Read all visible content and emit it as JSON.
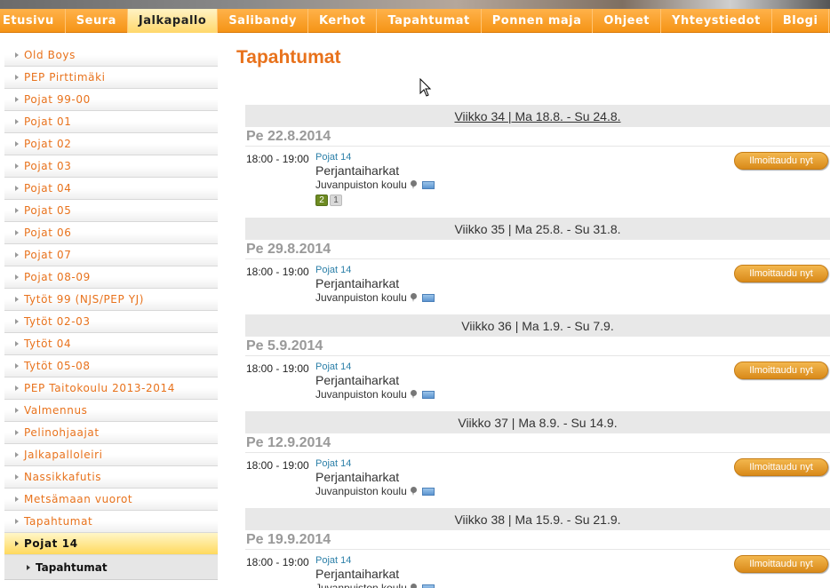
{
  "nav": {
    "items": [
      {
        "label": "Etusivu",
        "active": false
      },
      {
        "label": "Seura",
        "active": false
      },
      {
        "label": "Jalkapallo",
        "active": true
      },
      {
        "label": "Salibandy",
        "active": false
      },
      {
        "label": "Kerhot",
        "active": false
      },
      {
        "label": "Tapahtumat",
        "active": false
      },
      {
        "label": "Ponnen maja",
        "active": false
      },
      {
        "label": "Ohjeet",
        "active": false
      },
      {
        "label": "Yhteystiedot",
        "active": false
      },
      {
        "label": "Blogi",
        "active": false
      }
    ]
  },
  "sidebar": {
    "items": [
      {
        "label": "Old Boys"
      },
      {
        "label": "PEP Pirttimäki"
      },
      {
        "label": "Pojat 99-00"
      },
      {
        "label": "Pojat 01"
      },
      {
        "label": "Pojat 02"
      },
      {
        "label": "Pojat 03"
      },
      {
        "label": "Pojat 04"
      },
      {
        "label": "Pojat 05"
      },
      {
        "label": "Pojat 06"
      },
      {
        "label": "Pojat 07"
      },
      {
        "label": "Pojat 08-09"
      },
      {
        "label": "Tytöt 99 (NJS/PEP YJ)"
      },
      {
        "label": "Tytöt 02-03"
      },
      {
        "label": "Tytöt 04"
      },
      {
        "label": "Tytöt 05-08"
      },
      {
        "label": "PEP Taitokoulu 2013-2014"
      },
      {
        "label": "Valmennus"
      },
      {
        "label": "Pelinohjaajat"
      },
      {
        "label": "Jalkapalloleiri"
      },
      {
        "label": "Nassikkafutis"
      },
      {
        "label": "Metsämaan vuorot"
      },
      {
        "label": "Tapahtumat"
      },
      {
        "label": "Pojat 14",
        "active": true
      }
    ],
    "sub_item": {
      "label": "Tapahtumat"
    }
  },
  "main": {
    "title": "Tapahtumat"
  },
  "weeks": [
    {
      "header": "Viikko 34 | Ma 18.8. - Su 24.8.",
      "linked": true,
      "day": "Pe 22.8.2014",
      "time": "18:00 - 19:00",
      "team": "Pojat 14",
      "name": "Perjantaiharkat",
      "location": "Juvanpuiston koulu",
      "counts": {
        "yes": "2",
        "maybe": "1"
      },
      "signup": "Ilmoittaudu nyt"
    },
    {
      "header": "Viikko 35 | Ma 25.8. - Su 31.8.",
      "linked": false,
      "day": "Pe 29.8.2014",
      "time": "18:00 - 19:00",
      "team": "Pojat 14",
      "name": "Perjantaiharkat",
      "location": "Juvanpuiston koulu",
      "signup": "Ilmoittaudu nyt"
    },
    {
      "header": "Viikko 36 | Ma 1.9. - Su 7.9.",
      "linked": false,
      "day": "Pe 5.9.2014",
      "time": "18:00 - 19:00",
      "team": "Pojat 14",
      "name": "Perjantaiharkat",
      "location": "Juvanpuiston koulu",
      "signup": "Ilmoittaudu nyt"
    },
    {
      "header": "Viikko 37 | Ma 8.9. - Su 14.9.",
      "linked": false,
      "day": "Pe 12.9.2014",
      "time": "18:00 - 19:00",
      "team": "Pojat 14",
      "name": "Perjantaiharkat",
      "location": "Juvanpuiston koulu",
      "signup": "Ilmoittaudu nyt"
    },
    {
      "header": "Viikko 38 | Ma 15.9. - Su 21.9.",
      "linked": false,
      "day": "Pe 19.9.2014",
      "time": "18:00 - 19:00",
      "team": "Pojat 14",
      "name": "Perjantaiharkat",
      "location": "Juvanpuiston koulu",
      "signup": "Ilmoittaudu nyt"
    }
  ],
  "colors": {
    "accent": "#e8721c",
    "nav_orange": "#f59416",
    "button_orange": "#d98a1a",
    "link_blue": "#2b7fa8"
  },
  "icons": {
    "location": "map-pin-icon",
    "map": "map-icon",
    "cursor": "mouse-cursor-icon"
  }
}
